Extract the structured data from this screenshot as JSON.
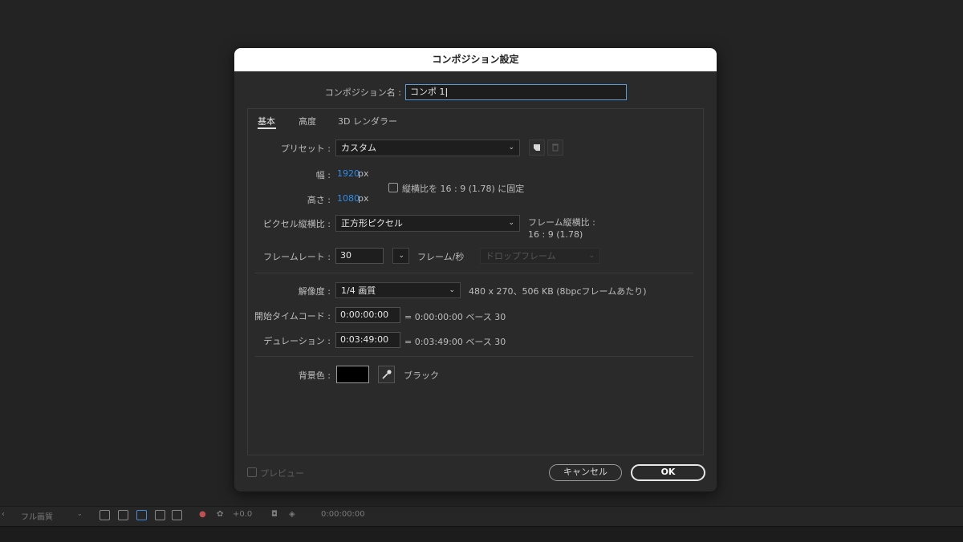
{
  "dialog": {
    "title": "コンポジション設定",
    "comp_name_label": "コンポジション名 :",
    "comp_name_value": "コンポ 1",
    "tabs": [
      {
        "label": "基本"
      },
      {
        "label": "高度"
      },
      {
        "label": "3D レンダラー"
      }
    ],
    "preset_label": "プリセット :",
    "preset_value": "カスタム",
    "width_label": "幅 :",
    "width_value": "1920",
    "width_unit": "px",
    "height_label": "高さ :",
    "height_value": "1080",
    "height_unit": "px",
    "lock_aspect_label": "縦横比を 16 : 9 (1.78) に固定",
    "pixel_aspect_label": "ピクセル縦横比 :",
    "pixel_aspect_value": "正方形ピクセル",
    "frame_aspect_label": "フレーム縦横比 :",
    "frame_aspect_value": "16 : 9 (1.78)",
    "framerate_label": "フレームレート :",
    "framerate_value": "30",
    "framerate_unit": "フレーム/秒",
    "drop_frame_value": "ドロップフレーム",
    "resolution_label": "解像度 :",
    "resolution_value": "1/4 画質",
    "resolution_info": "480 x 270、506 KB (8bpcフレームあたり)",
    "start_tc_label": "開始タイムコード :",
    "start_tc_value": "0:00:00:00",
    "start_tc_info": "= 0:00:00:00  ベース 30",
    "duration_label": "デュレーション :",
    "duration_value": "0:03:49:00",
    "duration_info": "= 0:03:49:00  ベース 30",
    "bg_color_label": "背景色 :",
    "bg_color_name": "ブラック",
    "bg_color_hex": "#000000",
    "preview_label": "プレビュー",
    "cancel_label": "キャンセル",
    "ok_label": "OK"
  },
  "statusbar": {
    "quality": "フル画質",
    "exposure": "+0.0",
    "timecode": "0:00:00:00"
  },
  "colors": {
    "accent_blue": "#2d8ceb",
    "background": "#232323",
    "dialog": "#2a2a2a"
  }
}
